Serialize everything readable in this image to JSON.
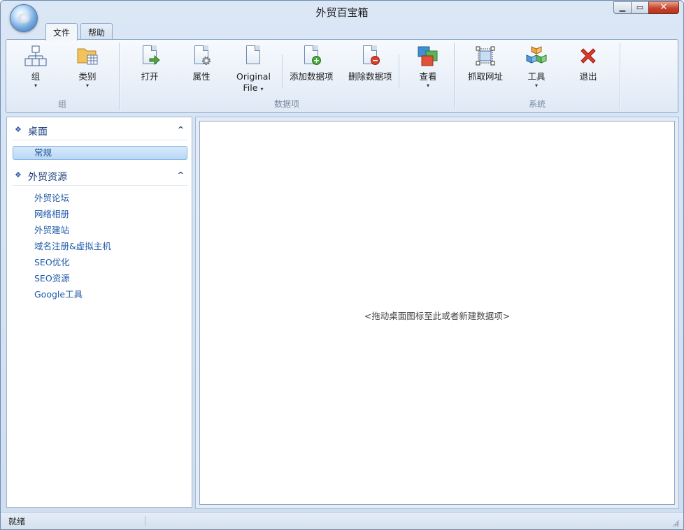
{
  "window": {
    "title": "外贸百宝箱"
  },
  "tabs": [
    {
      "label": "文件"
    },
    {
      "label": "帮助"
    }
  ],
  "ribbon": {
    "groups": [
      {
        "label": "组",
        "buttons": [
          {
            "label": "组",
            "icon": "org-chart-icon"
          },
          {
            "label": "类别",
            "icon": "folder-grid-icon"
          }
        ]
      },
      {
        "label": "数据项",
        "buttons": [
          {
            "label": "打开",
            "icon": "doc-open-icon"
          },
          {
            "label": "属性",
            "icon": "doc-gear-icon"
          },
          {
            "label": "Original",
            "label2": "File",
            "icon": "doc-plain-icon"
          },
          {
            "label": "添加数据项",
            "icon": "doc-add-icon"
          },
          {
            "label": "删除数据项",
            "icon": "doc-remove-icon"
          },
          {
            "label": "查看",
            "icon": "view-windows-icon"
          }
        ]
      },
      {
        "label": "系统",
        "buttons": [
          {
            "label": "抓取网址",
            "icon": "capture-frame-icon"
          },
          {
            "label": "工具",
            "icon": "toolbox-cubes-icon"
          },
          {
            "label": "退出",
            "icon": "exit-x-icon"
          }
        ]
      }
    ],
    "dropdown_arrow": "▾"
  },
  "sidebar": {
    "sections": [
      {
        "title": "桌面",
        "items": [
          "常规"
        ]
      },
      {
        "title": "外贸资源",
        "items": [
          "外贸论坛",
          "网络相册",
          "外贸建站",
          "域名注册&虚拟主机",
          "SEO优化",
          "SEO资源",
          "Google工具"
        ]
      }
    ],
    "section_bullet": "❖",
    "collapse_glyph": "^"
  },
  "content": {
    "hint": "<拖动桌面图标至此或者新建数据项>"
  },
  "status": {
    "text": "就绪"
  },
  "colors": {
    "accent": "#1e5aa8",
    "close_red": "#c8422a",
    "ribbon_bg": "#e6eef8"
  }
}
